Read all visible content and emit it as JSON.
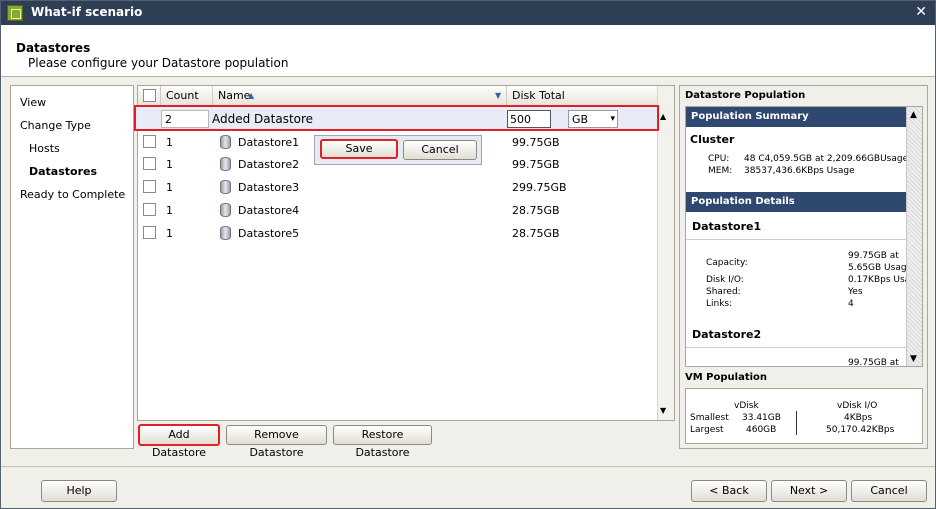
{
  "window": {
    "title": "What-if scenario",
    "close_glyph": "✕"
  },
  "header": {
    "title": "Datastores",
    "subtitle": "Please configure your Datastore population"
  },
  "nav": {
    "items": [
      {
        "label": "View"
      },
      {
        "label": "Change Type"
      },
      {
        "label": "Hosts"
      },
      {
        "label": "Datastores"
      },
      {
        "label": "Ready to Complete"
      }
    ]
  },
  "grid": {
    "columns": {
      "count": "Count",
      "name": "Name",
      "disk_total": "Disk Total"
    },
    "sort_indicator": "▲",
    "dropdown_glyph": "▼",
    "edit_row": {
      "count": "2",
      "name": "Added Datastore",
      "disk": "500",
      "unit": "GB",
      "unit_arrow": "▾"
    },
    "rows": [
      {
        "count": "1",
        "name": "Datastore1",
        "disk": "99.75GB"
      },
      {
        "count": "1",
        "name": "Datastore2",
        "disk": "99.75GB"
      },
      {
        "count": "1",
        "name": "Datastore3",
        "disk": "299.75GB"
      },
      {
        "count": "1",
        "name": "Datastore4",
        "disk": "28.75GB"
      },
      {
        "count": "1",
        "name": "Datastore5",
        "disk": "28.75GB"
      }
    ],
    "save_label": "Save",
    "cancel_label": "Cancel",
    "scroll_up": "▲",
    "scroll_down": "▼"
  },
  "actions": {
    "add": "Add Datastore",
    "remove": "Remove Datastore",
    "restore": "Restore Datastore"
  },
  "right": {
    "title": "Datastore Population",
    "summary_header": "Population Summary",
    "cluster_label": "Cluster",
    "cpu_label": "CPU:",
    "cpu_value": "48 C4,059.5GB at   2,209.66GBUsage",
    "mem_label": "MEM:",
    "mem_value": "38537,436.6KBps Usage",
    "details_header": "Population Details",
    "ds1": {
      "name": "Datastore1",
      "capacity_label": "Capacity:",
      "capacity_value_1": "99.75GB at",
      "capacity_value_2": "5.65GB Usag",
      "diskio_label": "Disk I/O:",
      "diskio_value": "0.17KBps Usa",
      "shared_label": "Shared:",
      "shared_value": "Yes",
      "links_label": "Links:",
      "links_value": "4"
    },
    "ds2": {
      "name": "Datastore2",
      "capacity_value_1": "99.75GB at"
    },
    "scroll_up": "▲",
    "scroll_down": "▼"
  },
  "vm": {
    "title": "VM Population",
    "vdisk_label": "vDisk",
    "vdiskio_label": "vDisk I/O",
    "smallest_label": "Smallest",
    "largest_label": "Largest",
    "smallest_vdisk": "33.41GB",
    "largest_vdisk": "460GB",
    "smallest_io": "4KBps",
    "largest_io": "50,170.42KBps"
  },
  "footer": {
    "help": "Help",
    "back": "< Back",
    "next": "Next >",
    "cancel": "Cancel"
  }
}
